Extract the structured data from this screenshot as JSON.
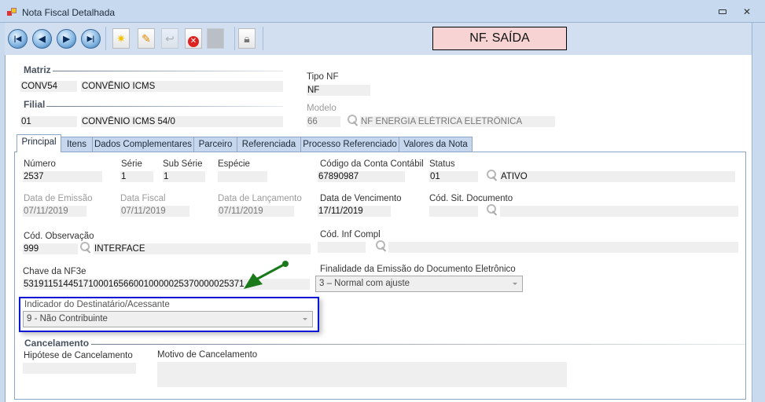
{
  "window": {
    "title": "Nota Fiscal Detalhada",
    "minimize": "▭",
    "close": "✕"
  },
  "toolbar": {
    "badge": "NF. SAÍDA",
    "nav_first": "|◀",
    "nav_prev": "◀",
    "nav_next": "▶",
    "nav_last": "▶|"
  },
  "matriz": {
    "label": "Matriz",
    "code": "CONV54",
    "name": "CONVÊNIO ICMS"
  },
  "filial": {
    "label": "Filial",
    "code": "01",
    "name": "CONVÊNIO ICMS 54/0"
  },
  "tipo_nf": {
    "label": "Tipo NF",
    "value": "NF"
  },
  "modelo": {
    "label": "Modelo",
    "code": "66",
    "name": "NF ENERGIA ELÉTRICA ELETRÔNICA"
  },
  "tabs": [
    {
      "label": "Principal",
      "active": true
    },
    {
      "label": "Itens"
    },
    {
      "label": "Dados Complementares"
    },
    {
      "label": "Parceiro"
    },
    {
      "label": "Referenciada"
    },
    {
      "label": "Processo Referenciado"
    },
    {
      "label": "Valores da Nota"
    }
  ],
  "principal": {
    "numero": {
      "label": "Número",
      "value": "2537"
    },
    "serie": {
      "label": "Série",
      "value": "1"
    },
    "sub_serie": {
      "label": "Sub Série",
      "value": "1"
    },
    "especie": {
      "label": "Espécie",
      "value": ""
    },
    "conta_contabil": {
      "label": "Código da Conta Contábil",
      "value": "67890987"
    },
    "status": {
      "label": "Status",
      "code": "01",
      "name": "ATIVO"
    },
    "data_emissao": {
      "label": "Data de Emissão",
      "value": "07/11/2019"
    },
    "data_fiscal": {
      "label": "Data Fiscal",
      "value": "07/11/2019"
    },
    "data_lancamento": {
      "label": "Data de Lançamento",
      "value": "07/11/2019"
    },
    "data_vencimento": {
      "label": "Data de Vencimento",
      "value": "17/11/2019"
    },
    "cod_sit_documento": {
      "label": "Cód. Sit. Documento",
      "code": "",
      "name": ""
    },
    "cod_observacao": {
      "label": "Cód. Observação",
      "code": "999",
      "name": "INTERFACE"
    },
    "cod_inf_compl": {
      "label": "Cód. Inf Compl",
      "code": "",
      "name": ""
    },
    "chave": {
      "label": "Chave da NF3e",
      "value": "53191151445171000165660010000025370000025371"
    },
    "finalidade": {
      "label": "Finalidade da Emissão do Documento Eletrônico",
      "value": "3 – Normal com ajuste"
    },
    "indicador": {
      "label": "Indicador do Destinatário/Acessante",
      "value": "9 - Não Contribuinte"
    },
    "cancelamento": {
      "label": "Cancelamento",
      "hipotese_label": "Hipótese de Cancelamento",
      "hipotese": "",
      "motivo_label": "Motivo de Cancelamento",
      "motivo": ""
    }
  },
  "colors": {
    "highlight": "#0a16d6",
    "arrow": "#1a7a1a",
    "badge_bg": "#f7d3d3"
  }
}
